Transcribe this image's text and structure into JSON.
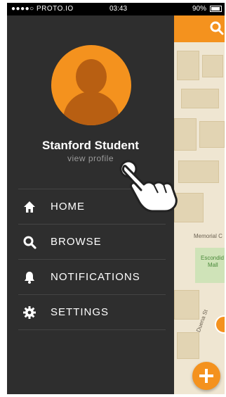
{
  "status_bar": {
    "carrier": "●●●●○ PROTO.IO",
    "time": "03:43",
    "battery": "90%"
  },
  "profile": {
    "name": "Stanford Student",
    "link": "view profile"
  },
  "menu": [
    {
      "label": "HOME",
      "icon": "home-icon"
    },
    {
      "label": "BROWSE",
      "icon": "search-icon"
    },
    {
      "label": "NOTIFICATIONS",
      "icon": "bell-icon"
    },
    {
      "label": "SETTINGS",
      "icon": "gear-icon"
    }
  ],
  "map": {
    "labels": [
      "Memorial C",
      "Escondid",
      "Mall",
      "Duena St"
    ]
  },
  "colors": {
    "accent": "#f4921e",
    "drawer": "#2e2e2e"
  }
}
